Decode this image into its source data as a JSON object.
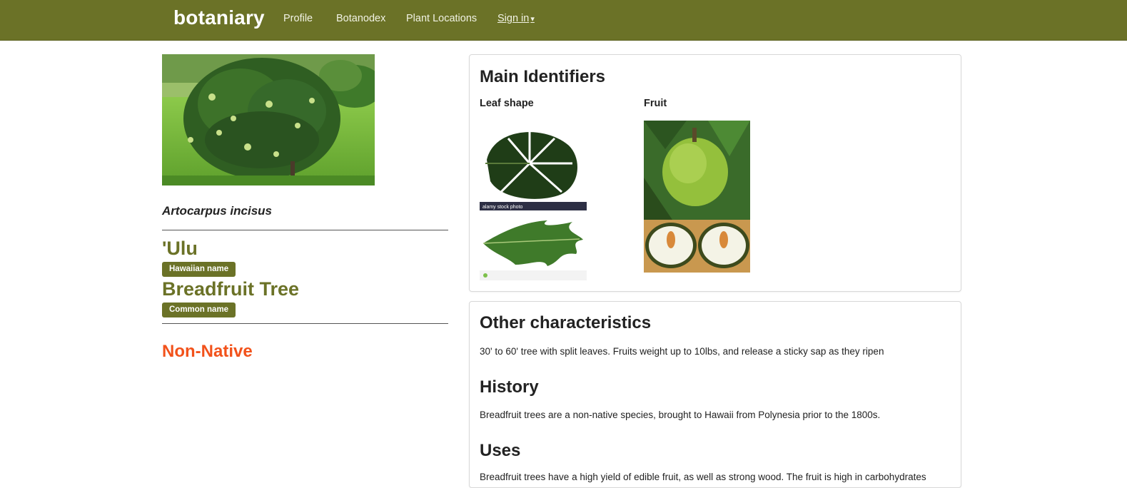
{
  "navbar": {
    "brand": "botaniary",
    "links": [
      "Profile",
      "Botanodex",
      "Plant Locations"
    ],
    "signin": "Sign in",
    "signin_caret": "▾",
    "bg_color": "#6b7227"
  },
  "plant": {
    "scientific_name": "Artocarpus incisus",
    "names": [
      {
        "name": "'Ulu",
        "label": "Hawaiian name"
      },
      {
        "name": "Breadfruit Tree",
        "label": "Common name"
      }
    ],
    "status": "Non-Native",
    "status_color": "#f2521b"
  },
  "identifiers": {
    "title": "Main Identifiers",
    "leaf_label": "Leaf shape",
    "fruit_label": "Fruit",
    "watermark": "alamy stock photo"
  },
  "characteristics": {
    "other_title": "Other characteristics",
    "other_text": "30' to 60' tree with split leaves. Fruits weight up to 10lbs, and release a sticky sap as they ripen",
    "history_title": "History",
    "history_text": "Breadfruit trees are a non-native species, brought to Hawaii from Polynesia prior to the 1800s.",
    "uses_title": "Uses",
    "uses_text": "Breadfruit trees have a high yield of edible fruit, as well as strong wood. The fruit is high in carbohydrates"
  }
}
